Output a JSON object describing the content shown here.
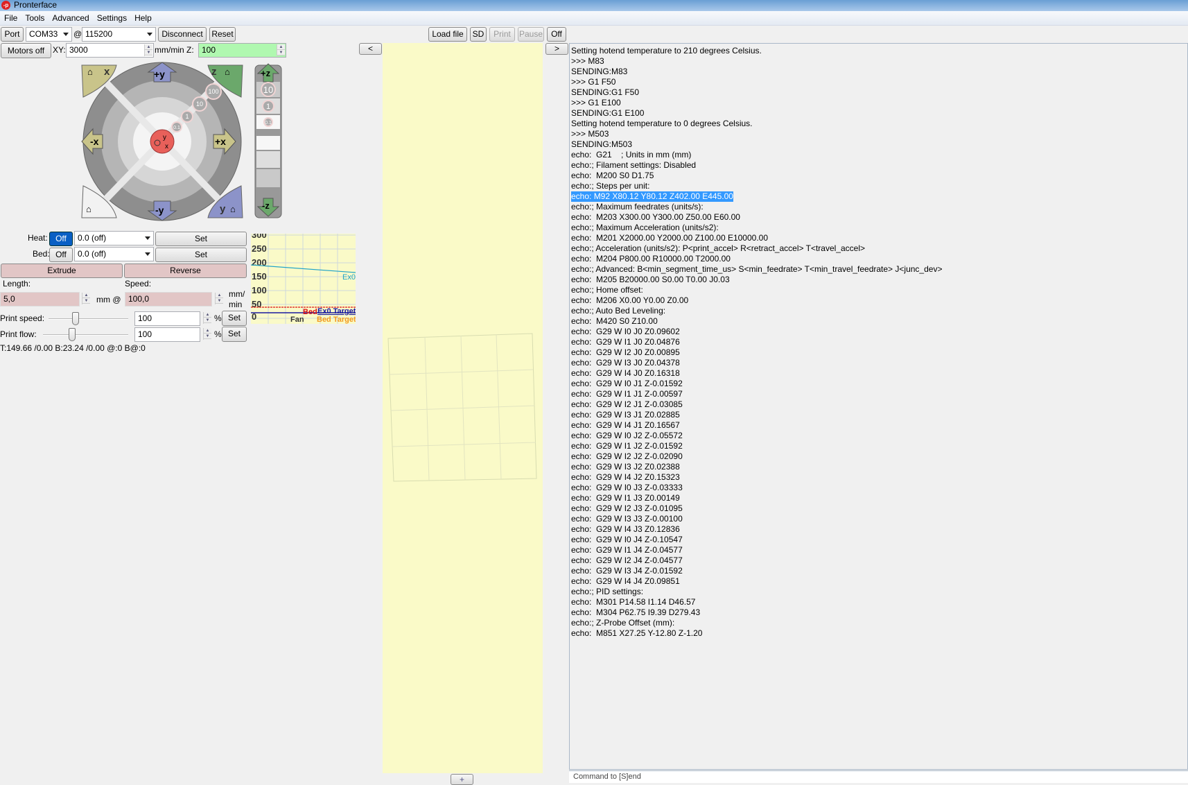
{
  "window": {
    "title": "Pronterface",
    "logo": "-p"
  },
  "menu": [
    "File",
    "Tools",
    "Advanced",
    "Settings",
    "Help"
  ],
  "toolbar": {
    "port": "Port",
    "com": "COM33",
    "at": "@",
    "baud": "115200",
    "disconnect": "Disconnect",
    "reset": "Reset",
    "load_file": "Load file",
    "sd": "SD",
    "print": "Print",
    "pause": "Pause",
    "off": "Off"
  },
  "movement": {
    "motors_off": "Motors off",
    "xy_label": "XY:",
    "xy_value": "3000",
    "mmmin_z": "mm/min Z:",
    "z_value": "100"
  },
  "jog": {
    "home_x": "x",
    "home_z": "z",
    "home_y": "y",
    "plus_y": "+y",
    "minus_y": "-y",
    "plus_x": "+x",
    "minus_x": "-x",
    "plus_z": "+z",
    "minus_z": "-z",
    "steps": [
      "100",
      "10",
      "1",
      "0.1"
    ],
    "zsteps": [
      "10",
      "1",
      "0.1"
    ],
    "center_y": "y",
    "center_x": "x"
  },
  "temp": {
    "heat_label": "Heat:",
    "heat_off": "Off",
    "heat_value": "0.0 (off)",
    "set": "Set",
    "bed_label": "Bed:",
    "bed_off": "Off",
    "bed_value": "0.0 (off)"
  },
  "extrude": {
    "extrude": "Extrude",
    "reverse": "Reverse",
    "length_label": "Length:",
    "speed_label": "Speed:",
    "length": "5,0",
    "mm_at": "mm @",
    "speed": "100,0",
    "unit1": "mm/",
    "unit2": "min"
  },
  "print_speed": {
    "label": "Print speed:",
    "value": "100",
    "pct": "%",
    "set": "Set",
    "slider": 0.35
  },
  "print_flow": {
    "label": "Print flow:",
    "value": "100",
    "pct": "%",
    "set": "Set",
    "slider": 0.35
  },
  "status": "T:149.66 /0.00 B:23.24 /0.00 @:0 B@:0",
  "graph": {
    "yticks": [
      "300",
      "250",
      "200",
      "150",
      "100",
      "50",
      "0"
    ],
    "ex0": "Ex0",
    "bed": "Bed",
    "ex0_target": "Ex0 Target",
    "fan": "Fan",
    "bed_target": "Bed Target",
    "colors": {
      "ex0": "#1fa3c9",
      "bed": "#d11",
      "ex0_target": "#1a1aa0",
      "bed_target": "#f39a20"
    }
  },
  "panel": {
    "left": "<",
    "right": ">",
    "plus": "+"
  },
  "log": [
    "Setting hotend temperature to 210 degrees Celsius.",
    ">>> M83",
    "SENDING:M83",
    ">>> G1 F50",
    "SENDING:G1 F50",
    ">>> G1 E100",
    "SENDING:G1 E100",
    "Setting hotend temperature to 0 degrees Celsius.",
    ">>> M503",
    "SENDING:M503",
    "echo:  G21    ; Units in mm (mm)",
    "echo:; Filament settings: Disabled",
    "echo:  M200 S0 D1.75",
    "echo:; Steps per unit:",
    "echo: M92 X80.12 Y80.12 Z402.00 E445.00",
    "echo:; Maximum feedrates (units/s):",
    "echo:  M203 X300.00 Y300.00 Z50.00 E60.00",
    "echo:; Maximum Acceleration (units/s2):",
    "echo:  M201 X2000.00 Y2000.00 Z100.00 E10000.00",
    "echo:; Acceleration (units/s2): P<print_accel> R<retract_accel> T<travel_accel>",
    "echo:  M204 P800.00 R10000.00 T2000.00",
    "echo:; Advanced: B<min_segment_time_us> S<min_feedrate> T<min_travel_feedrate> J<junc_dev>",
    "echo:  M205 B20000.00 S0.00 T0.00 J0.03",
    "echo:; Home offset:",
    "echo:  M206 X0.00 Y0.00 Z0.00",
    "echo:; Auto Bed Leveling:",
    "echo:  M420 S0 Z10.00",
    "echo:  G29 W I0 J0 Z0.09602",
    "echo:  G29 W I1 J0 Z0.04876",
    "echo:  G29 W I2 J0 Z0.00895",
    "echo:  G29 W I3 J0 Z0.04378",
    "echo:  G29 W I4 J0 Z0.16318",
    "echo:  G29 W I0 J1 Z-0.01592",
    "echo:  G29 W I1 J1 Z-0.00597",
    "echo:  G29 W I2 J1 Z-0.03085",
    "echo:  G29 W I3 J1 Z0.02885",
    "echo:  G29 W I4 J1 Z0.16567",
    "echo:  G29 W I0 J2 Z-0.05572",
    "echo:  G29 W I1 J2 Z-0.01592",
    "echo:  G29 W I2 J2 Z-0.02090",
    "echo:  G29 W I3 J2 Z0.02388",
    "echo:  G29 W I4 J2 Z0.15323",
    "echo:  G29 W I0 J3 Z-0.03333",
    "echo:  G29 W I1 J3 Z0.00149",
    "echo:  G29 W I2 J3 Z-0.01095",
    "echo:  G29 W I3 J3 Z-0.00100",
    "echo:  G29 W I4 J3 Z0.12836",
    "echo:  G29 W I0 J4 Z-0.10547",
    "echo:  G29 W I1 J4 Z-0.04577",
    "echo:  G29 W I2 J4 Z-0.04577",
    "echo:  G29 W I3 J4 Z-0.01592",
    "echo:  G29 W I4 J4 Z0.09851",
    "echo:; PID settings:",
    "echo:  M301 P14.58 I1.14 D46.57",
    "echo:  M304 P62.75 I9.39 D279.43",
    "echo:; Z-Probe Offset (mm):",
    "echo:  M851 X27.25 Y-12.80 Z-1.20"
  ],
  "log_selected_index": 14,
  "command_placeholder": "Command to [S]end"
}
